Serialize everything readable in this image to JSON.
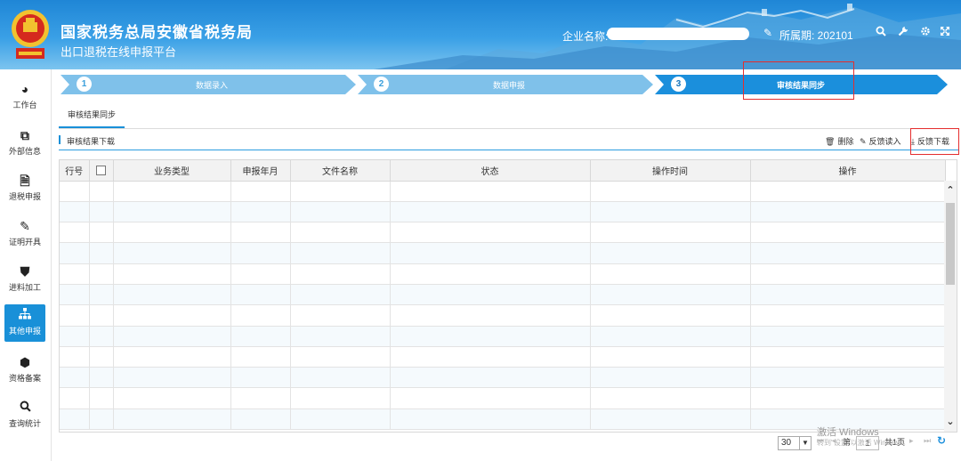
{
  "header": {
    "title": "国家税务总局安徽省税务局",
    "subtitle": "出口退税在线申报平台",
    "company_label": "企业名称:",
    "period_label": "所属期: 202101",
    "icons": [
      "edit-icon",
      "search-icon",
      "wrench-icon",
      "gear-icon",
      "fullscreen-icon"
    ]
  },
  "sidebar": {
    "items": [
      {
        "label": "工作台",
        "icon": "dashboard-icon"
      },
      {
        "label": "外部信息",
        "icon": "external-info-icon"
      },
      {
        "label": "退税申报",
        "icon": "document-icon"
      },
      {
        "label": "证明开具",
        "icon": "edit-certificate-icon"
      },
      {
        "label": "进料加工",
        "icon": "shield-icon"
      },
      {
        "label": "其他申报",
        "icon": "org-chart-icon",
        "active": true
      },
      {
        "label": "资格备案",
        "icon": "cube-icon"
      },
      {
        "label": "查询统计",
        "icon": "search-icon"
      }
    ]
  },
  "steps": [
    {
      "num": "1",
      "label": "数据录入"
    },
    {
      "num": "2",
      "label": "数据申报"
    },
    {
      "num": "3",
      "label": "审核结果同步",
      "active": true
    }
  ],
  "tabs": [
    {
      "label": "审核结果同步"
    }
  ],
  "toolbar": {
    "title": "审核结果下载",
    "delete_label": "删除",
    "feedback_read_label": "反馈读入",
    "feedback_download_label": "反馈下载"
  },
  "table": {
    "columns": [
      "行号",
      "",
      "业务类型",
      "申报年月",
      "文件名称",
      "状态",
      "操作时间",
      "操作"
    ],
    "rows": []
  },
  "pager": {
    "page_size": "30",
    "page_prefix": "第",
    "page_value": "1",
    "total_label": "共1页"
  },
  "watermark": {
    "line1": "激活 Windows",
    "line2": "转到\"设置\"以激活 Windows。"
  },
  "colors": {
    "header_blue": "#1f86d6",
    "step_light": "#7fc1ea",
    "step_active": "#1b8fdc",
    "active_sidebar": "#1990d8",
    "highlight_red": "#e52d2d"
  }
}
